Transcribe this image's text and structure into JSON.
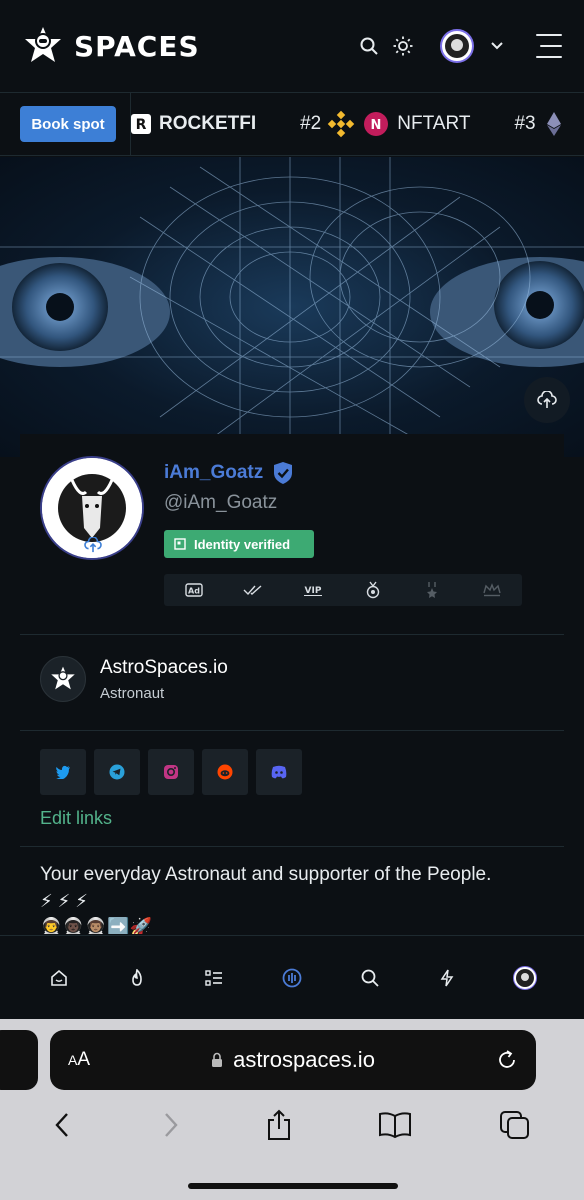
{
  "header": {
    "logo_text": "SPACES"
  },
  "ticker": {
    "book_button": "Book spot",
    "items": [
      {
        "rank": "",
        "name": "ROCKETFI"
      },
      {
        "rank": "#2",
        "name": "NFTART"
      },
      {
        "rank": "#3",
        "name": ""
      }
    ]
  },
  "profile": {
    "display_name": "iAm_Goatz",
    "handle": "@iAm_Goatz",
    "identity_badge": "Identity verified",
    "badge_icons": [
      "Ad",
      "double-check",
      "VIP",
      "medal",
      "star-medal",
      "crown"
    ]
  },
  "organization": {
    "name": "AstroSpaces.io",
    "role": "Astronaut"
  },
  "socials": [
    "twitter",
    "telegram",
    "instagram",
    "reddit",
    "discord"
  ],
  "edit_links": "Edit links",
  "bio": {
    "text": "Your everyday Astronaut and supporter of the People.",
    "line2": "⚡ ⚡ ⚡",
    "line3": "👨‍🚀👨🏿‍🚀👨🏽‍🚀➡️🚀"
  },
  "bottom_nav": [
    "home",
    "flame",
    "list",
    "spaces",
    "search",
    "bolt",
    "profile"
  ],
  "browser": {
    "aa_label": "AA",
    "url": "astrospaces.io"
  },
  "colors": {
    "background": "#0c1014",
    "accent_blue": "#3d7fd6",
    "verified_green": "#3daa73",
    "link_green": "#53b38b",
    "name_blue": "#4b7bd6"
  }
}
